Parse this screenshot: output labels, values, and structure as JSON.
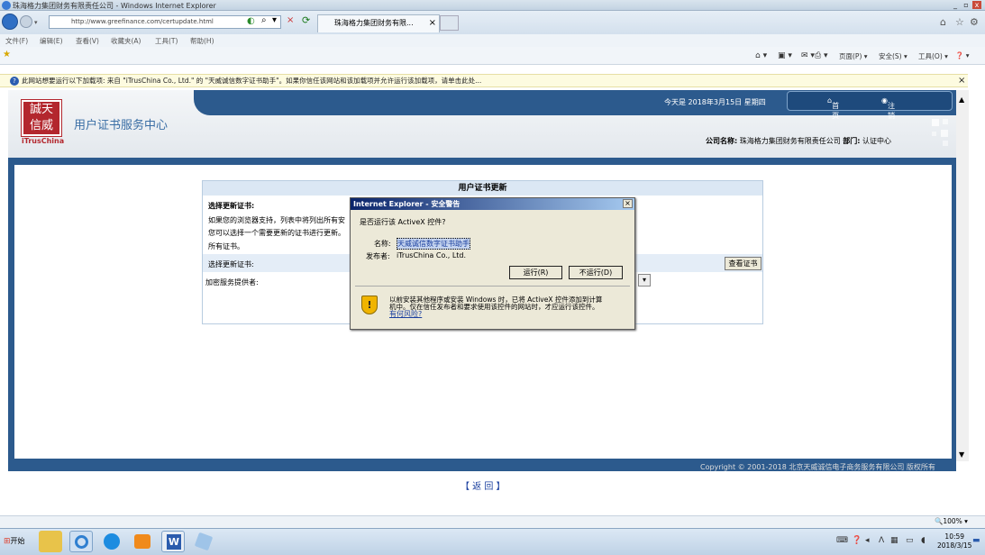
{
  "window": {
    "title": "珠海格力集团财务有限责任公司 - Windows Internet Explorer",
    "min": "_",
    "max": "▫",
    "close": "x"
  },
  "nav": {
    "address": "http://www.greefinance.com/certupdate.html",
    "tab_title": "珠海格力集团财务有限...",
    "tab_close": "×",
    "search_glyph": "⌕",
    "stop_glyph": "×",
    "refresh_glyph": "⟳"
  },
  "menubar": {
    "items": [
      "文件(F)",
      "编辑(E)",
      "查看(V)",
      "收藏夹(A)",
      "工具(T)",
      "帮助(H)"
    ]
  },
  "commandbar": {
    "page": "页面(P) ▾",
    "safety": "安全(S) ▾",
    "tools": "工具(O) ▾",
    "help": "❓ ▾"
  },
  "infobar": {
    "text": "此网站想要运行以下加载项: 来自 \"iTrusChina Co., Ltd.\" 的 \"天威诚信数字证书助手\"。如果你信任该网站和该加载项并允许运行该加载项，请单击此处...",
    "close": "×"
  },
  "site": {
    "logo_chars": "誠天信威",
    "logo_text": "iTrusChina",
    "title": "用户证书服务中心",
    "today": "今天是 2018年3月15日 星期四",
    "nav_home": "首页",
    "nav_logout": "注销",
    "company_label": "公司名称:",
    "company_name": "珠海格力集团财务有限责任公司",
    "dept_label": "部门:",
    "dept_name": "认证中心",
    "copyright": "Copyright © 2001-2018 北京天威诚信电子商务服务有限公司 版权所有",
    "back": "【 返 回 】"
  },
  "panel": {
    "title": "用户证书更新",
    "select_heading": "选择更新证书:",
    "desc_line1": "如果您的浏览器支持，列表中将列出所有安",
    "desc_line2": "您可以选择一个需要更新的证书进行更新。",
    "desc_line3": "所有证书。",
    "select_label": "选择更新证书:",
    "view_button": "查看证书",
    "csp_label": "加密服务提供者:",
    "dropdown_glyph": "▾"
  },
  "dialog": {
    "title": "Internet Explorer - 安全警告",
    "close": "×",
    "question": "是否运行该 ActiveX 控件?",
    "name_label": "名称:",
    "name_value": "天威诚信数字证书助手",
    "publisher_label": "发布者:",
    "publisher_value": "iTrusChina Co., Ltd.",
    "run_button": "运行(R)",
    "dont_run_button": "不运行(D)",
    "warning_line1": "以前安装其他程序或安装 Windows 时，已将 ActiveX 控件添加到计算",
    "warning_line2": "机中。仅在信任发布者和要求使用该控件的网站时，才应运行该控件。",
    "risk_link": "有何风险?",
    "shield_glyph": "!"
  },
  "status": {
    "zoom": "🔍100% ▾"
  },
  "taskbar": {
    "start": "开始",
    "time": "10:59",
    "date": "2018/3/15"
  }
}
